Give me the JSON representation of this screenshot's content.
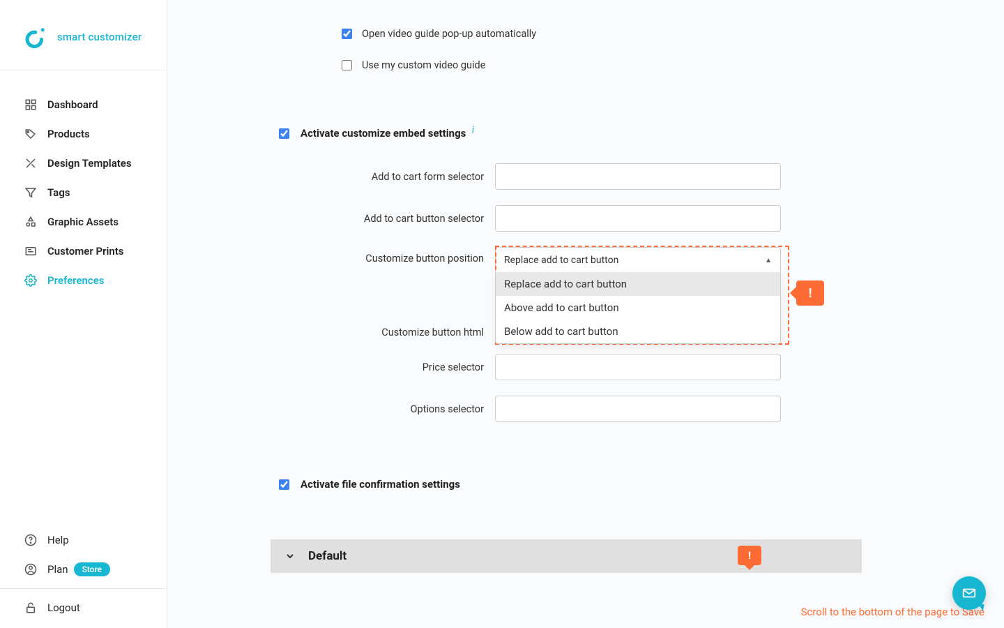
{
  "brand": "smart customizer",
  "nav": [
    {
      "label": "Dashboard"
    },
    {
      "label": "Products"
    },
    {
      "label": "Design Templates"
    },
    {
      "label": "Tags"
    },
    {
      "label": "Graphic Assets"
    },
    {
      "label": "Customer Prints"
    },
    {
      "label": "Preferences"
    }
  ],
  "bottom": {
    "help": "Help",
    "plan": "Plan",
    "plan_badge": "Store",
    "logout": "Logout"
  },
  "checks": {
    "open_video_guide": "Open video guide pop-up automatically",
    "use_custom_video_guide": "Use my custom video guide"
  },
  "embed_section": {
    "title": "Activate customize embed settings",
    "fields": {
      "form_selector": "Add to cart form selector",
      "button_selector": "Add to cart button selector",
      "button_position": "Customize button position",
      "button_html": "Customize button html",
      "price_selector": "Price selector",
      "options_selector": "Options selector"
    },
    "position_select": {
      "value": "Replace add to cart button",
      "options": [
        "Replace add to cart button",
        "Above add to cart button",
        "Below add to cart button"
      ]
    },
    "annot_symbol": "!"
  },
  "file_section": {
    "title": "Activate file confirmation settings"
  },
  "default_panel": "Default",
  "save_warn_symbol": "!",
  "save_text": "Scroll to the bottom of the page to Save"
}
